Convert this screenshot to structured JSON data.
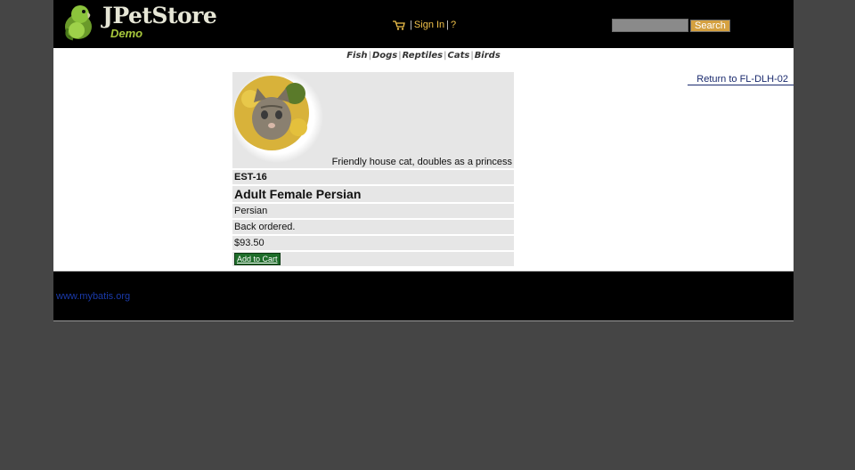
{
  "header": {
    "logo_title": "JPetStore",
    "logo_subtitle": "Demo",
    "logo_icon": "parrot-logo-icon",
    "cart_icon": "shopping-cart-icon",
    "menu_separator": "|",
    "sign_in_label": "Sign In",
    "help_label": "?",
    "search": {
      "value": "",
      "button_label": "Search"
    }
  },
  "quicklinks": {
    "separator": "|",
    "items": [
      "Fish",
      "Dogs",
      "Reptiles",
      "Cats",
      "Birds"
    ]
  },
  "back_link": "Return to FL-DLH-02",
  "item": {
    "image_icon": "kitten-photo",
    "description": "Friendly house cat, doubles as a princess",
    "id": "EST-16",
    "name": "Adult Female Persian",
    "attribute": "Persian",
    "stock": "Back ordered.",
    "price": "$93.50",
    "add_to_cart_label": "Add to Cart"
  },
  "footer": {
    "link": "www.mybatis.org"
  },
  "colors": {
    "page_background": "#454545",
    "header_background": "#000000",
    "menu_link": "#f0c14a",
    "search_button": "#d4a040",
    "row_background": "#e6e6e6",
    "add_to_cart": "#1e6d2a",
    "back_link": "#1a2a6e",
    "footer_link": "#1a3aaa"
  }
}
